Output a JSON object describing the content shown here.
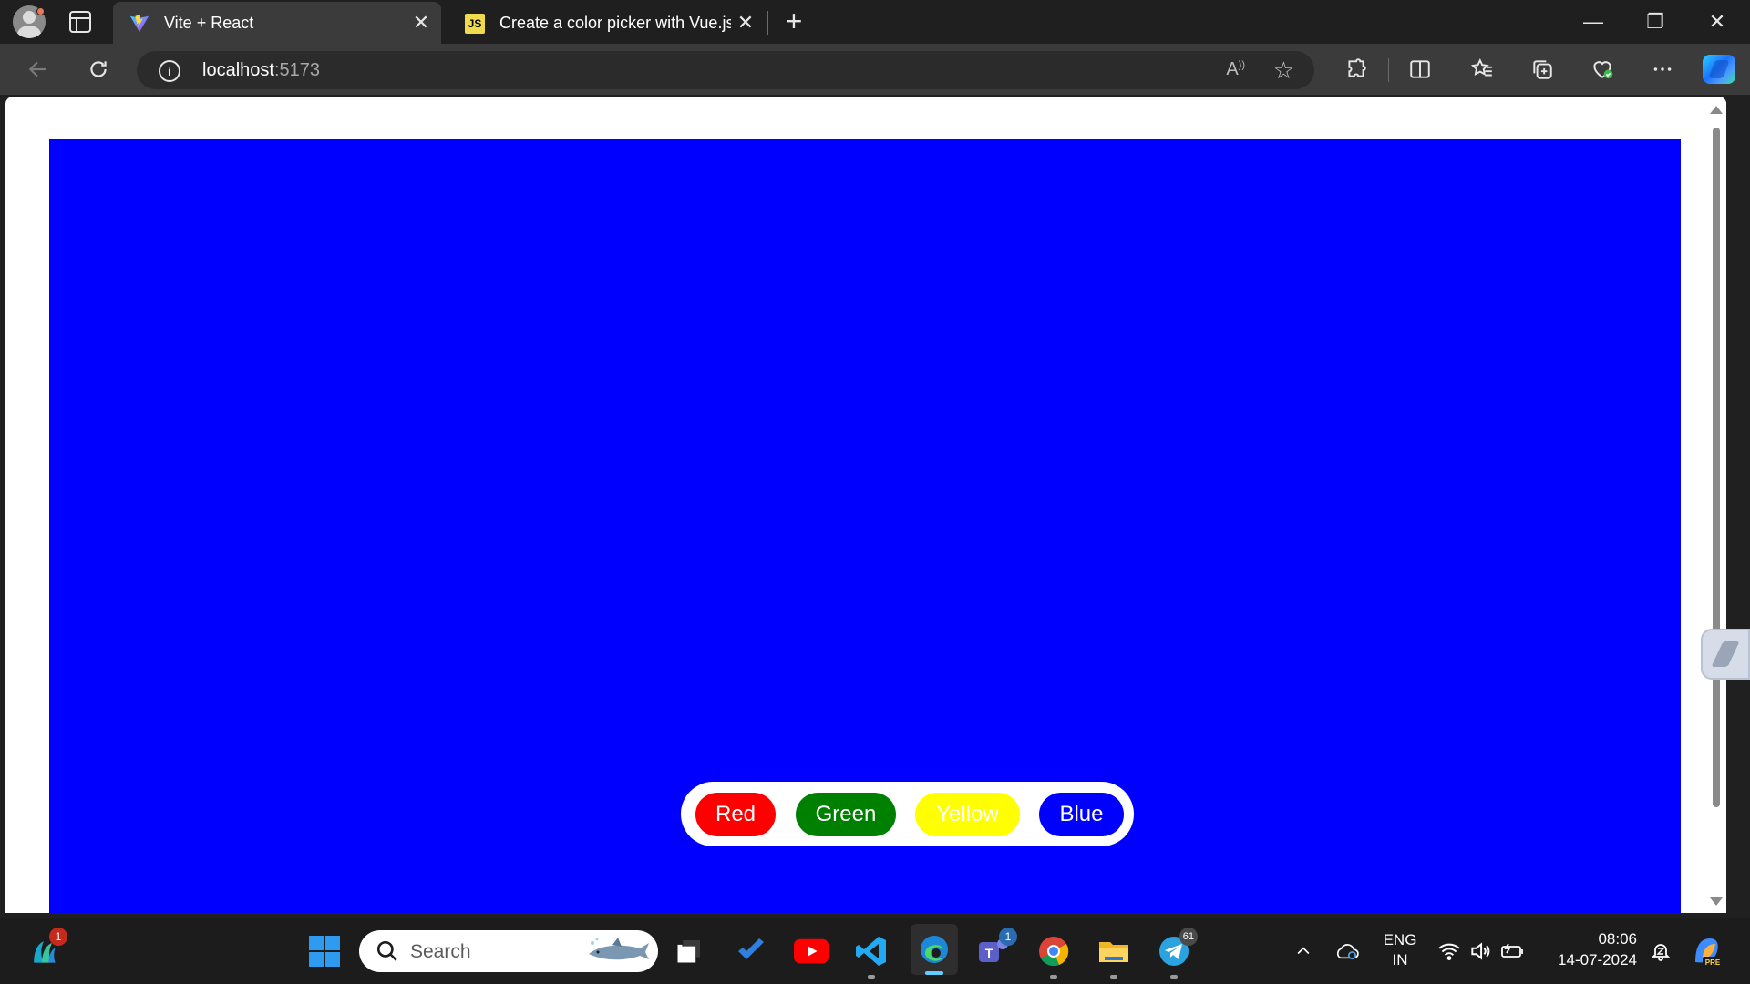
{
  "browser": {
    "tabs": [
      {
        "title": "Vite + React",
        "active": true,
        "favicon": "vite-icon"
      },
      {
        "title": "Create a color picker with Vue.js",
        "active": false,
        "favicon": "js-icon"
      }
    ],
    "url_host": "localhost",
    "url_port": ":5173"
  },
  "page": {
    "background_color": "#0000ff",
    "buttons": [
      {
        "label": "Red",
        "color": "#ff0000"
      },
      {
        "label": "Green",
        "color": "#008000"
      },
      {
        "label": "Yellow",
        "color": "#ffff00"
      },
      {
        "label": "Blue",
        "color": "#0000ff"
      }
    ]
  },
  "taskbar": {
    "search_placeholder": "Search",
    "language": "ENG",
    "region": "IN",
    "time": "08:06",
    "date": "14-07-2024",
    "badges": {
      "weather_app": "1",
      "teams": "1",
      "telegram": "61"
    }
  }
}
